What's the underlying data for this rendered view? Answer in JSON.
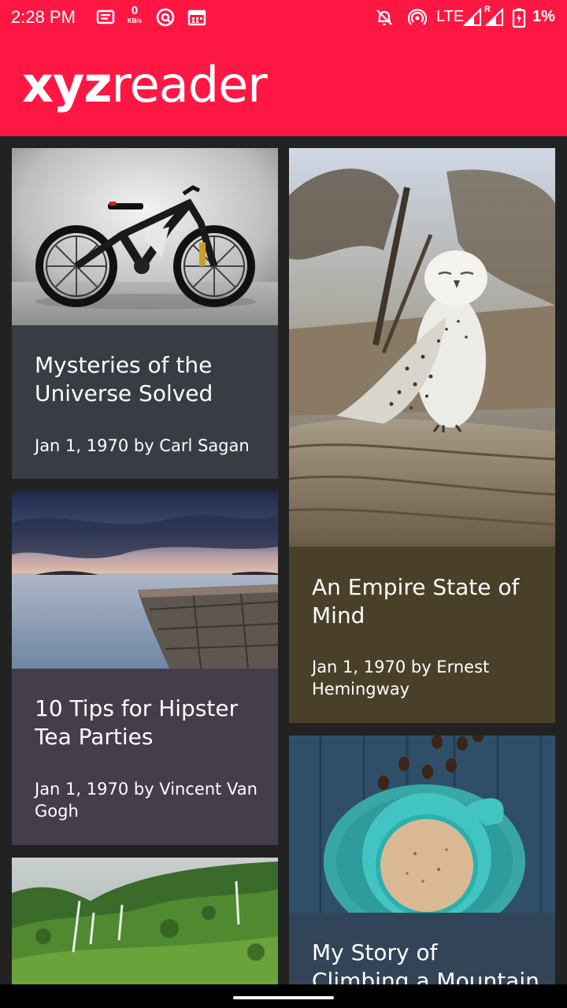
{
  "status_bar": {
    "time": "2:28 PM",
    "kbs_value": "0",
    "kbs_unit": "KB/s",
    "network": "LTE",
    "roaming": "R",
    "battery": "1%",
    "icons": [
      "message-icon",
      "kbs-icon",
      "target-icon",
      "calendar-icon",
      "bell-off-icon",
      "hotspot-icon",
      "signal-icon",
      "roaming-signal-icon",
      "battery-charging-icon"
    ]
  },
  "app_bar": {
    "logo_bold": "xyz",
    "logo_light": "reader",
    "background": "#ff1744"
  },
  "articles": [
    {
      "title": "Mysteries of the Universe Solved",
      "meta": "Jan 1, 1970 by Carl Sagan",
      "image": "bicycle",
      "card_color": "#383d44"
    },
    {
      "title": "An Empire State of Mind",
      "meta": "Jan 1, 1970 by Ernest Hemingway",
      "image": "snowy-owl",
      "card_color": "#4a4029"
    },
    {
      "title": "10 Tips for Hipster Tea Parties",
      "meta": "Jan 1, 1970 by Vincent Van Gogh",
      "image": "seashore-dusk",
      "card_color": "#453d4c"
    },
    {
      "title": "My Story of Climbing a Mountain",
      "meta": "",
      "image": "coffee-cup",
      "card_color": "#324558"
    },
    {
      "title": "",
      "meta": "",
      "image": "green-cliffs-waterfalls",
      "card_color": "#2f4a2a"
    }
  ]
}
